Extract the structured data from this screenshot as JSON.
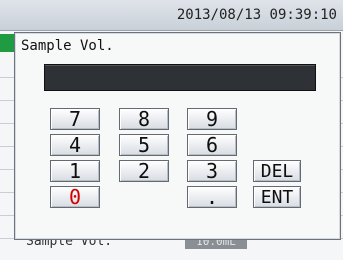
{
  "statusbar": {
    "datetime": "2013/08/13 09:39:10"
  },
  "background": {
    "bottom_label": "Sample Vol.",
    "bottom_value": "10.0mL"
  },
  "dialog": {
    "title": "Sample Vol.",
    "display_value": ""
  },
  "keypad": {
    "k7": "7",
    "k8": "8",
    "k9": "9",
    "k4": "4",
    "k5": "5",
    "k6": "6",
    "k1": "1",
    "k2": "2",
    "k3": "3",
    "del": "DEL",
    "k0": "0",
    "dot": ".",
    "ent": "ENT"
  },
  "colors": {
    "display_bg": "#2e3236",
    "accent_green": "#1f9b42",
    "zero_key_text": "#d40000"
  }
}
